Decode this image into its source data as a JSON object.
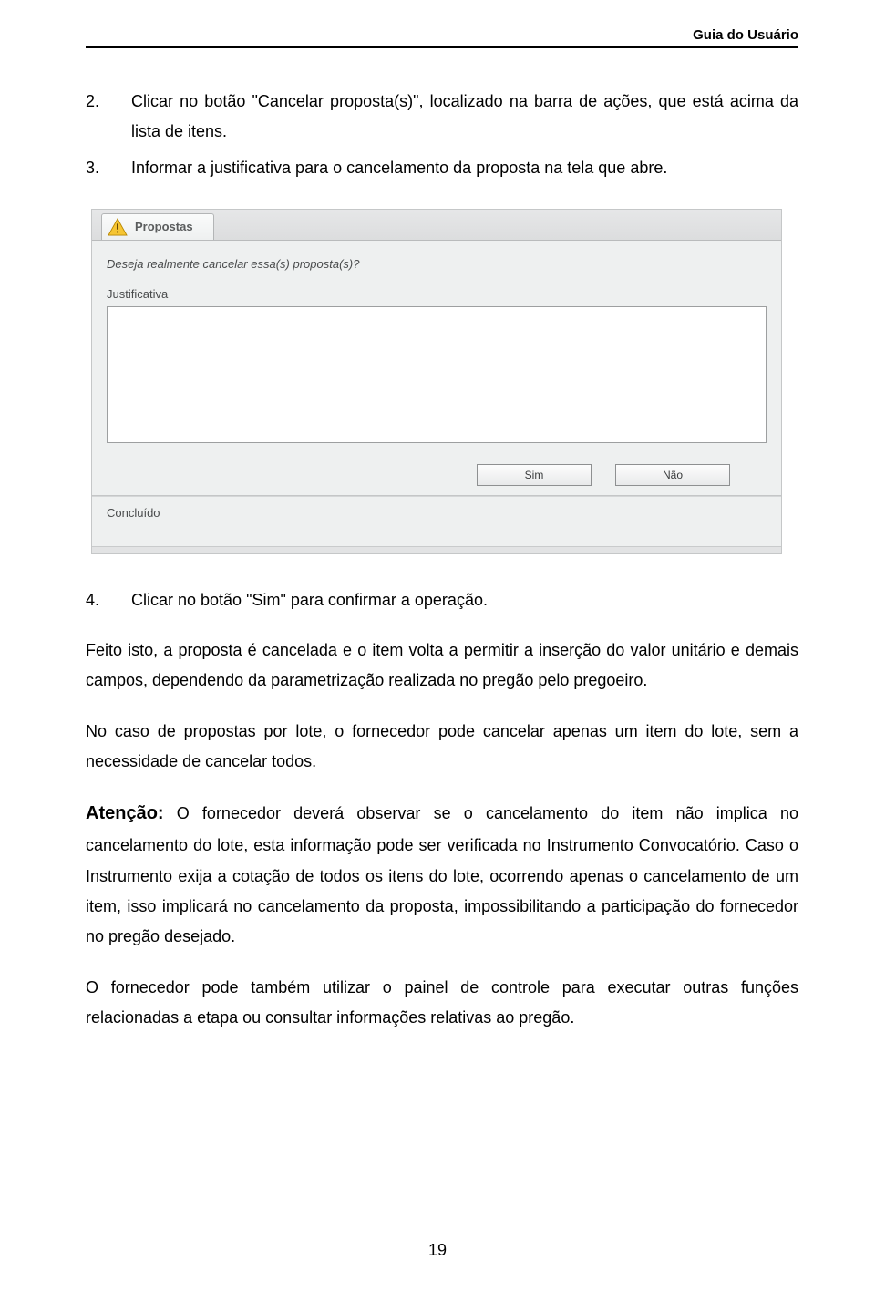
{
  "header": {
    "title": "Guia do Usuário"
  },
  "steps": {
    "s2_num": "2.",
    "s2_text": "Clicar no botão \"Cancelar proposta(s)\", localizado na barra de ações, que está acima da lista de itens.",
    "s3_num": "3.",
    "s3_text": "Informar a justificativa para o cancelamento da proposta na tela que abre.",
    "s4_num": "4.",
    "s4_text": "Clicar no botão \"Sim\" para confirmar a operação."
  },
  "dialog": {
    "title": "Propostas",
    "question": "Deseja realmente cancelar essa(s) proposta(s)?",
    "field_label": "Justificativa",
    "textarea_value": "",
    "btn_yes": "Sim",
    "btn_no": "Não",
    "status": "Concluído"
  },
  "body": {
    "p1": "Feito isto, a proposta é cancelada e o item volta a permitir a inserção do valor unitário e demais campos, dependendo da parametrização realizada no pregão pelo pregoeiro.",
    "p2": "No caso de propostas por lote, o fornecedor pode cancelar apenas um item do lote, sem a necessidade de cancelar todos.",
    "atencao_label": "Atenção:",
    "p3": " O fornecedor deverá observar se o cancelamento do item não implica no cancelamento do lote, esta informação pode ser verificada no Instrumento Convocatório. Caso o Instrumento exija a cotação de todos os itens do lote, ocorrendo apenas o cancelamento de um item, isso implicará no cancelamento da proposta, impossibilitando a participação do fornecedor no pregão desejado.",
    "p4": "O fornecedor pode também utilizar o painel de controle para executar outras funções relacionadas a etapa ou consultar informações relativas ao pregão."
  },
  "page_number": "19"
}
